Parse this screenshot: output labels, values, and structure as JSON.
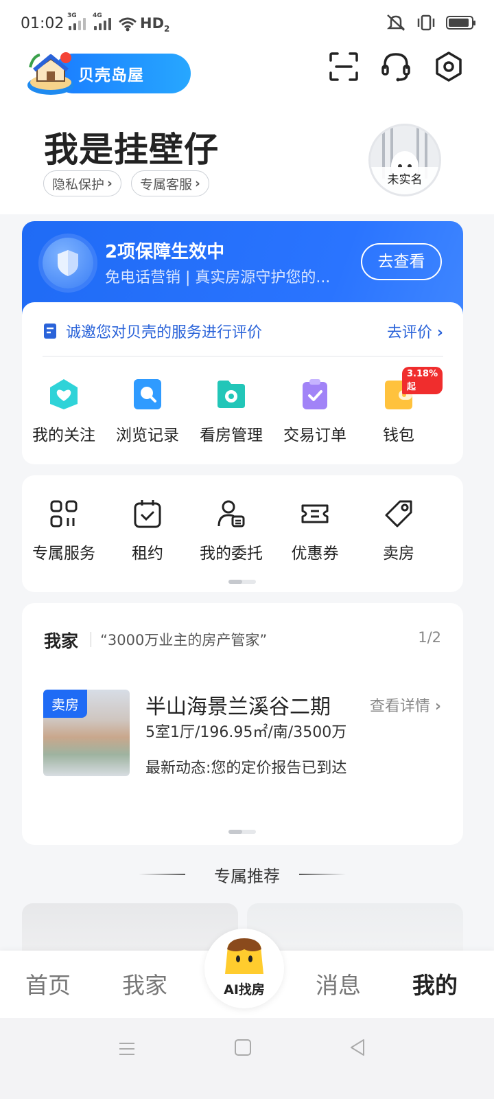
{
  "status_bar": {
    "time": "01:02",
    "net1": "3G",
    "net2": "4G",
    "hd": "HD",
    "hd_sub": "2",
    "battery_level": 0.9
  },
  "header": {
    "brand": "贝壳岛屋",
    "username": "我是挂壁仔",
    "chips": [
      "隐私保护",
      "专属客服"
    ],
    "avatar_label": "未实名"
  },
  "guarantee": {
    "title": "2项保障生效中",
    "subtitle": "免电话营销 | 真实房源守护您的...",
    "button": "去查看"
  },
  "review": {
    "text": "诚邀您对贝壳的服务进行评价",
    "link": "去评价"
  },
  "quick_actions": [
    {
      "label": "我的关注",
      "icon": "heart-folder-icon",
      "color": "#2fd3d8"
    },
    {
      "label": "浏览记录",
      "icon": "search-history-icon",
      "color": "#2f9bff"
    },
    {
      "label": "看房管理",
      "icon": "house-viewing-icon",
      "color": "#22c6b8"
    },
    {
      "label": "交易订单",
      "icon": "order-check-icon",
      "color": "#a183f7"
    },
    {
      "label": "钱包",
      "icon": "wallet-icon",
      "color": "#ffc23d",
      "badge": "3.18%起"
    }
  ],
  "services": [
    {
      "label": "专属服务",
      "icon": "apps-grid-icon"
    },
    {
      "label": "租约",
      "icon": "calendar-check-icon"
    },
    {
      "label": "我的委托",
      "icon": "user-entrust-icon"
    },
    {
      "label": "优惠券",
      "icon": "coupon-icon"
    },
    {
      "label": "卖房",
      "icon": "price-tag-icon"
    }
  ],
  "my_home": {
    "title": "我家",
    "slogan": "“3000万业主的房产管家”",
    "page": "1/2",
    "house": {
      "tag": "卖房",
      "name": "半山海景兰溪谷二期",
      "spec": "5室1厅/196.95㎡/南/3500万",
      "news": "最新动态:您的定价报告已到达",
      "detail_link": "查看详情"
    }
  },
  "recommend": {
    "title": "专属推荐"
  },
  "bottom_nav": {
    "items": [
      "首页",
      "我家",
      "消息",
      "我的"
    ],
    "ai_label": "AI找房",
    "active": "我的"
  },
  "colors": {
    "brand_blue": "#1f6bf5",
    "link_blue": "#2a63d9",
    "badge_red": "#f02d2d"
  }
}
